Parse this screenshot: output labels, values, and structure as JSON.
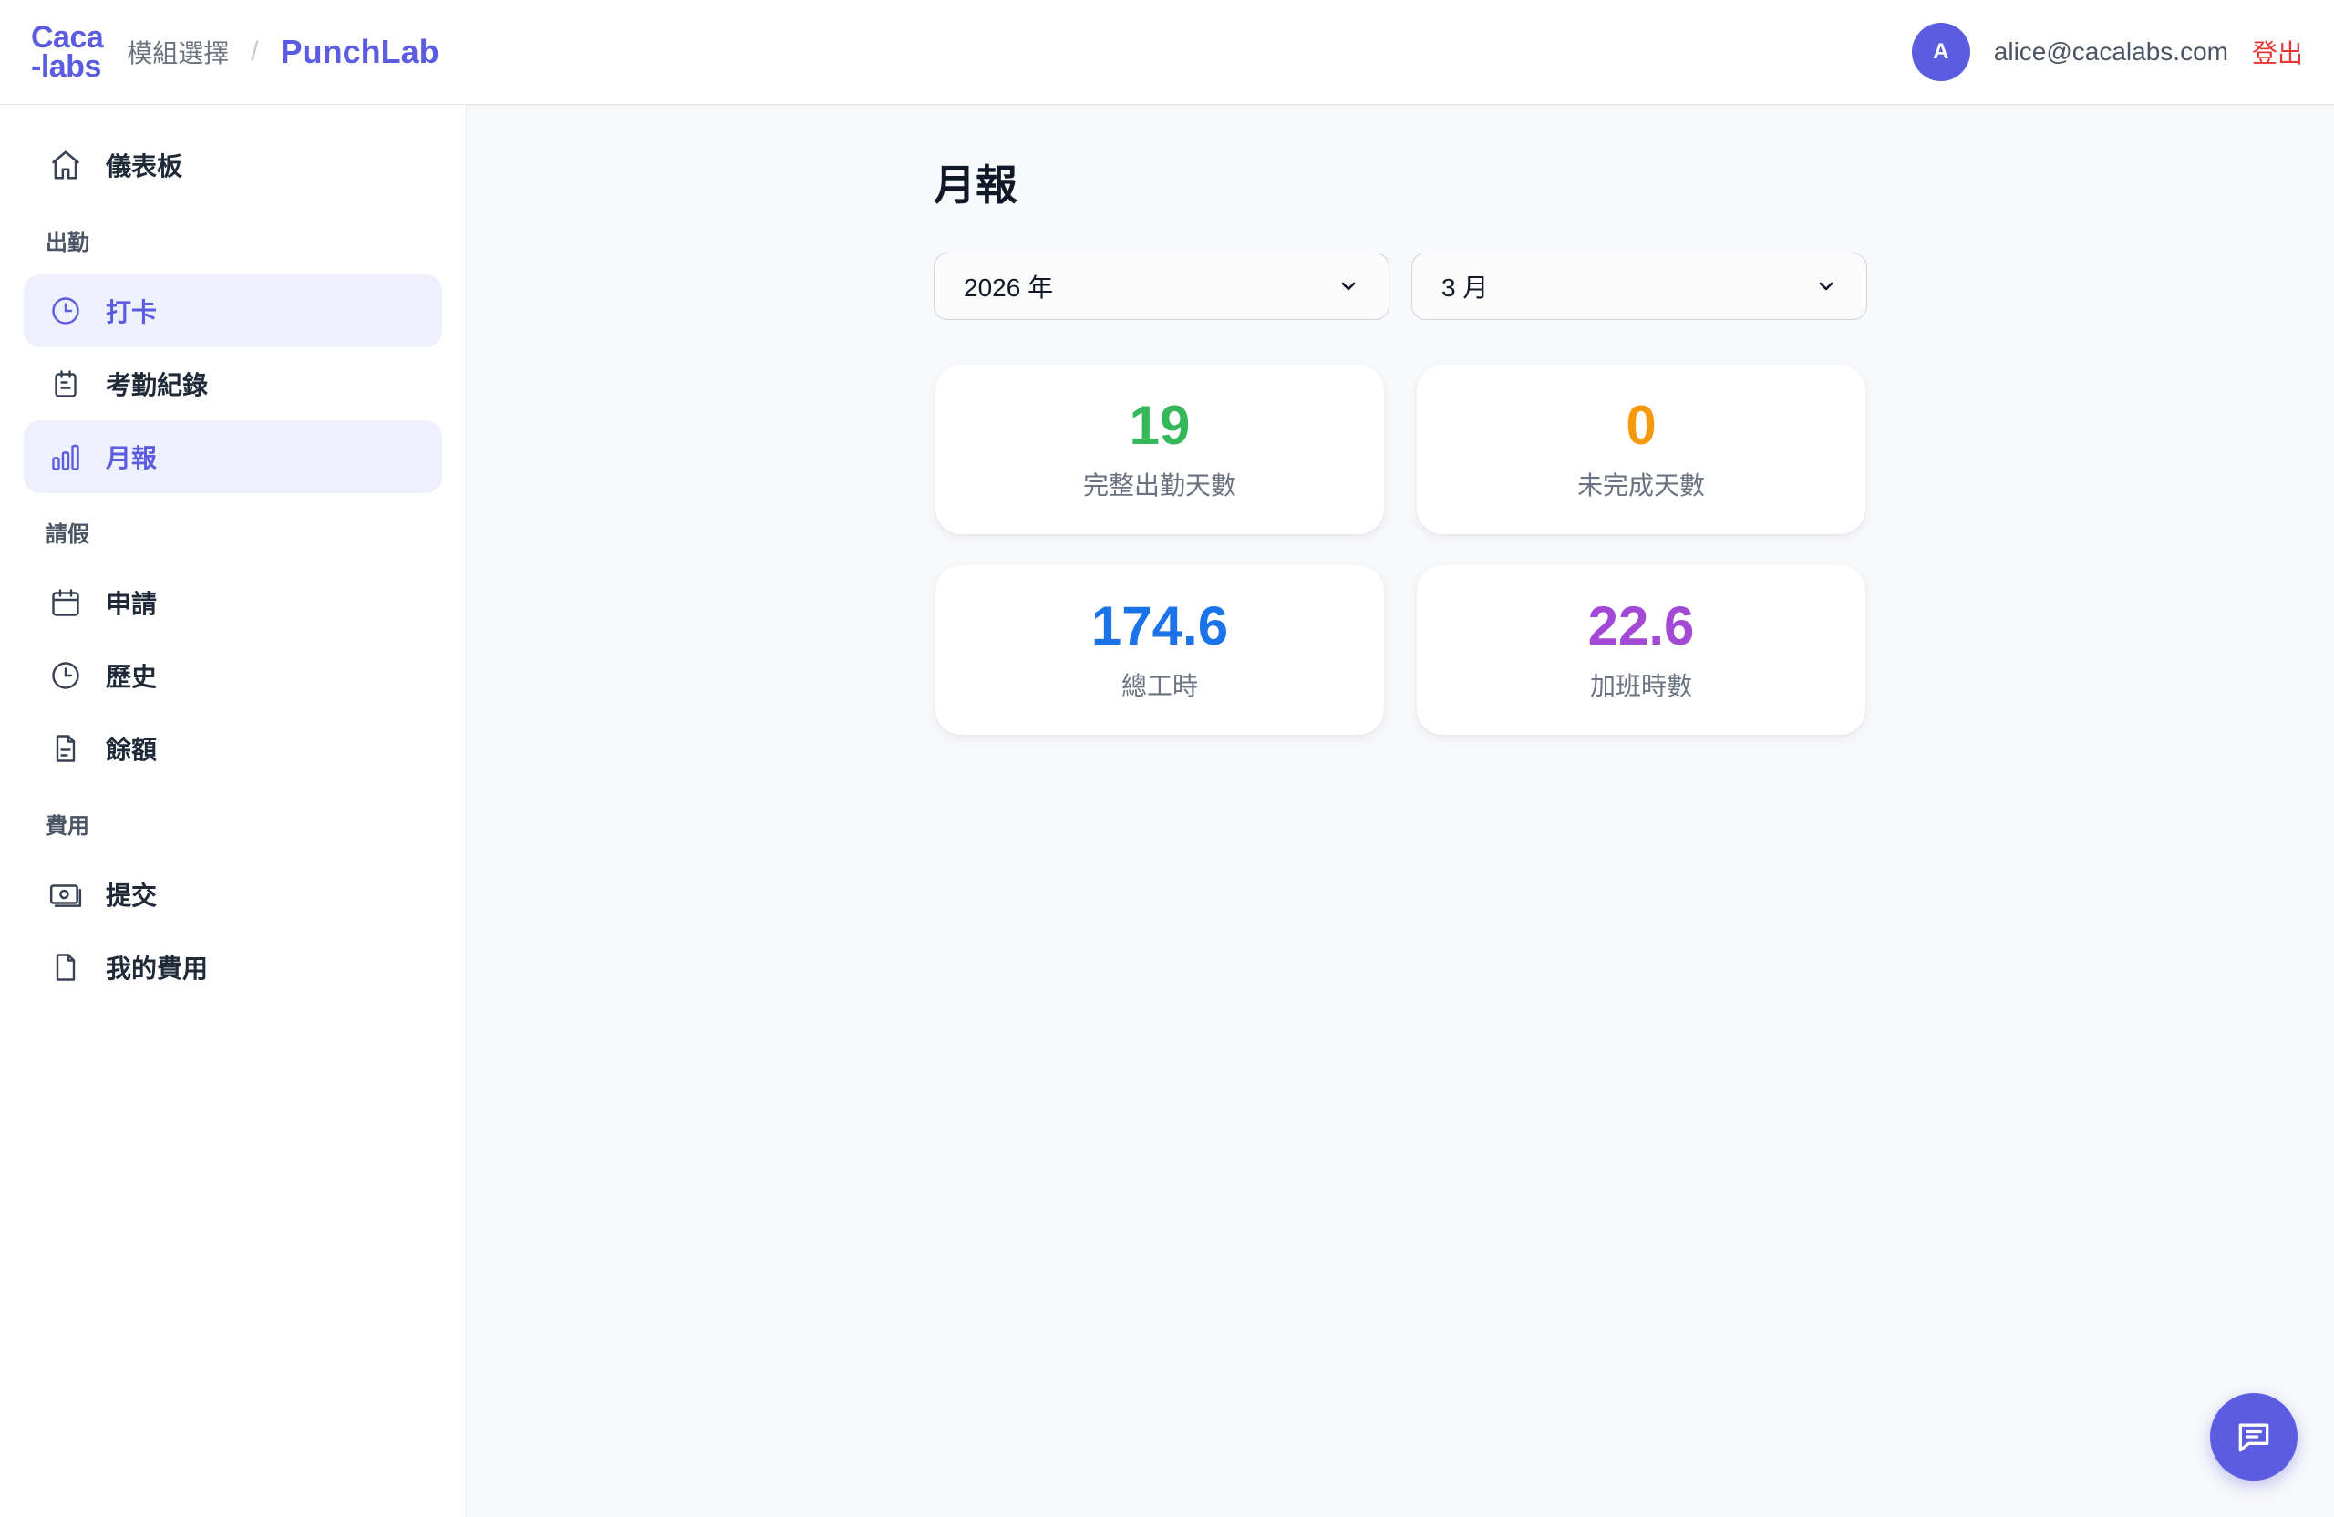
{
  "header": {
    "logo_line1": "Caca",
    "logo_line2": "-labs",
    "module_select": "模組選擇",
    "separator": "/",
    "app_name": "PunchLab",
    "avatar_initial": "A",
    "user_email": "alice@cacalabs.com",
    "logout": "登出"
  },
  "sidebar": {
    "dashboard": {
      "label": "儀表板",
      "icon": "home-icon"
    },
    "sections": [
      {
        "title": "出勤",
        "items": [
          {
            "label": "打卡",
            "icon": "clock-icon",
            "active": true
          },
          {
            "label": "考勤紀錄",
            "icon": "clipboard-icon",
            "active": false
          },
          {
            "label": "月報",
            "icon": "bar-chart-icon",
            "active": true
          }
        ]
      },
      {
        "title": "請假",
        "items": [
          {
            "label": "申請",
            "icon": "calendar-icon",
            "active": false
          },
          {
            "label": "歷史",
            "icon": "clock-icon",
            "active": false
          },
          {
            "label": "餘額",
            "icon": "document-icon",
            "active": false
          }
        ]
      },
      {
        "title": "費用",
        "items": [
          {
            "label": "提交",
            "icon": "banknote-icon",
            "active": false
          },
          {
            "label": "我的費用",
            "icon": "file-icon",
            "active": false
          }
        ]
      }
    ]
  },
  "main": {
    "title": "月報",
    "year_select": "2026 年",
    "month_select": "3 月",
    "stats": [
      {
        "value": "19",
        "label": "完整出勤天數",
        "color": "#34b85a"
      },
      {
        "value": "0",
        "label": "未完成天數",
        "color": "#f59a0c"
      },
      {
        "value": "174.6",
        "label": "總工時",
        "color": "#1a73e8"
      },
      {
        "value": "22.6",
        "label": "加班時數",
        "color": "#a24ad6"
      }
    ]
  },
  "colors": {
    "brand": "#5b5ce0",
    "logout": "#e53935",
    "active_bg": "#eef0fd"
  },
  "chat_button": {
    "icon": "chat-icon"
  }
}
